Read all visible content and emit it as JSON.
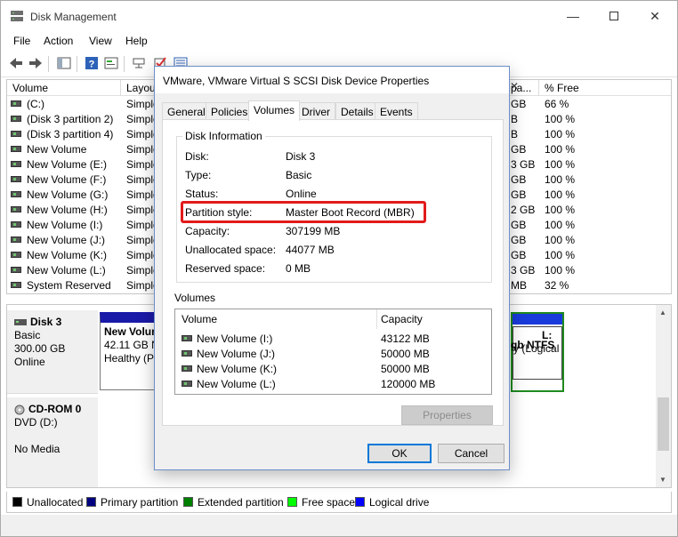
{
  "window": {
    "title": "Disk Management"
  },
  "menu": [
    "File",
    "Action",
    "View",
    "Help"
  ],
  "list": {
    "headers": {
      "volume": "Volume",
      "layout": "Layou",
      "free": "pa...",
      "pct": "% Free"
    },
    "rows": [
      {
        "name": "(C:)",
        "layout": "Simple",
        "free": "GB",
        "pct": "66 %"
      },
      {
        "name": "(Disk 3 partition 2)",
        "layout": "Simple",
        "free": "B",
        "pct": "100 %"
      },
      {
        "name": "(Disk 3 partition 4)",
        "layout": "Simple",
        "free": "B",
        "pct": "100 %"
      },
      {
        "name": "New Volume",
        "layout": "Simple",
        "free": "GB",
        "pct": "100 %"
      },
      {
        "name": "New Volume (E:)",
        "layout": "Simple",
        "free": "3 GB",
        "pct": "100 %"
      },
      {
        "name": "New Volume (F:)",
        "layout": "Simple",
        "free": "GB",
        "pct": "100 %"
      },
      {
        "name": "New Volume (G:)",
        "layout": "Simple",
        "free": "GB",
        "pct": "100 %"
      },
      {
        "name": "New Volume (H:)",
        "layout": "Simple",
        "free": "2 GB",
        "pct": "100 %"
      },
      {
        "name": "New Volume (I:)",
        "layout": "Simple",
        "free": "GB",
        "pct": "100 %"
      },
      {
        "name": "New Volume (J:)",
        "layout": "Simple",
        "free": "GB",
        "pct": "100 %"
      },
      {
        "name": "New Volume (K:)",
        "layout": "Simple",
        "free": "GB",
        "pct": "100 %"
      },
      {
        "name": "New Volume (L:)",
        "layout": "Simple",
        "free": "3 GB",
        "pct": "100 %"
      },
      {
        "name": "System Reserved",
        "layout": "Simple",
        "free": "MB",
        "pct": "32 %"
      }
    ]
  },
  "disks": {
    "disk3": {
      "name": "Disk 3",
      "type": "Basic",
      "size": "300.00 GB",
      "status": "Online"
    },
    "partition_left": {
      "title": "New Volum",
      "size": "42.11 GB N",
      "status": "Healthy (P"
    },
    "partition_right": {
      "title": "gb NTFS",
      "size": "y (Logical",
      "top": "L:"
    },
    "cdrom": {
      "name": "CD-ROM 0",
      "type": "DVD (D:)",
      "status": "No Media"
    }
  },
  "legend": [
    {
      "label": "Unallocated",
      "color": "#000000"
    },
    {
      "label": "Primary partition",
      "color": "#000080"
    },
    {
      "label": "Extended partition",
      "color": "#008000"
    },
    {
      "label": "Free space",
      "color": "#00ff00"
    },
    {
      "label": "Logical drive",
      "color": "#0000ff"
    }
  ],
  "dialog": {
    "title": "VMware, VMware Virtual S SCSI Disk Device Properties",
    "tabs": [
      "General",
      "Policies",
      "Volumes",
      "Driver",
      "Details",
      "Events"
    ],
    "active_tab": "Volumes",
    "disk_info_title": "Disk Information",
    "fields": [
      {
        "label": "Disk:",
        "value": "Disk 3"
      },
      {
        "label": "Type:",
        "value": "Basic"
      },
      {
        "label": "Status:",
        "value": "Online"
      },
      {
        "label": "Partition style:",
        "value": "Master Boot Record (MBR)"
      },
      {
        "label": "Capacity:",
        "value": "307199 MB"
      },
      {
        "label": "Unallocated space:",
        "value": "44077 MB"
      },
      {
        "label": "Reserved space:",
        "value": "0 MB"
      }
    ],
    "volumes_title": "Volumes",
    "volumes_headers": {
      "volume": "Volume",
      "capacity": "Capacity"
    },
    "volumes": [
      {
        "name": "New Volume (I:)",
        "capacity": "43122 MB"
      },
      {
        "name": "New Volume (J:)",
        "capacity": "50000 MB"
      },
      {
        "name": "New Volume (K:)",
        "capacity": "50000 MB"
      },
      {
        "name": "New Volume (L:)",
        "capacity": "120000 MB"
      }
    ],
    "properties_button": "Properties",
    "ok_button": "OK",
    "cancel_button": "Cancel"
  }
}
